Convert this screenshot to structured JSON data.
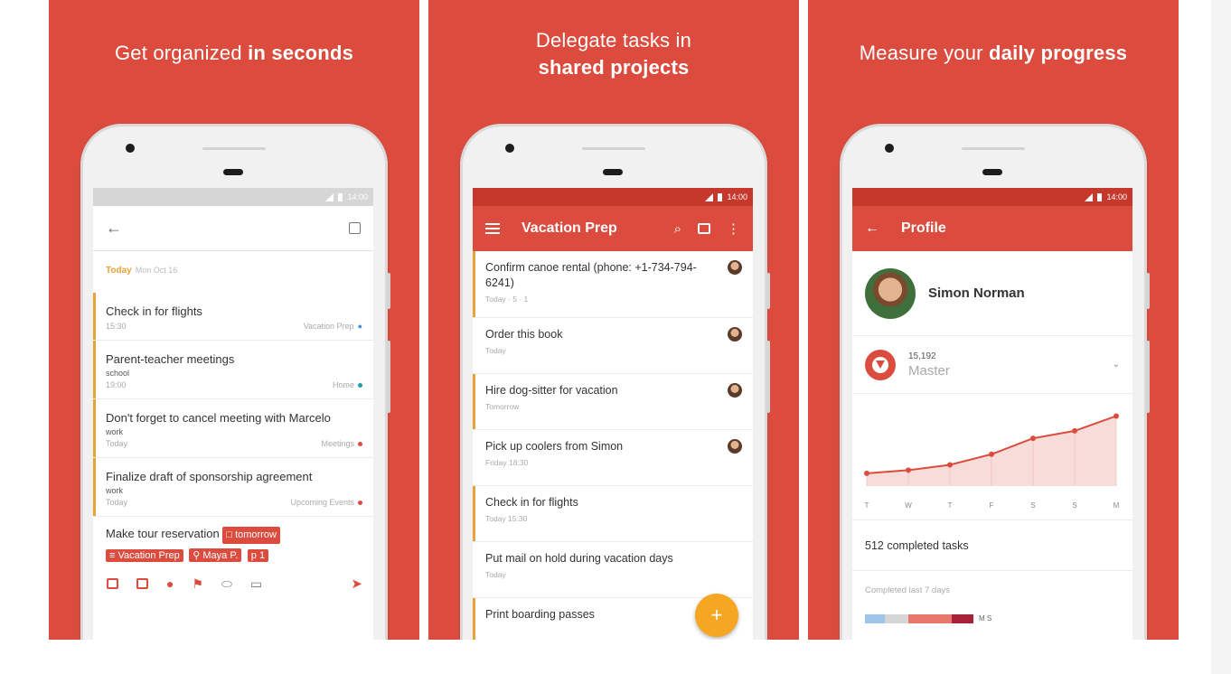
{
  "colors": {
    "brand_red": "#db4c3f",
    "status_red": "#c7382c",
    "today_orange": "#e8a23a",
    "fab_orange": "#f5a623"
  },
  "screens": [
    {
      "caption_pre": "Get organized ",
      "caption_bold": "in seconds",
      "status_time": "14:00",
      "day_label": "Today",
      "day_date": "Mon Oct 16",
      "tasks": [
        {
          "title": "Check in for flights",
          "sub": "",
          "time": "15:30",
          "project": "Vacation Prep"
        },
        {
          "title": "Parent-teacher meetings",
          "sub": "school",
          "time": "19:00",
          "project": "Home"
        },
        {
          "title": "Don't forget to cancel meeting with Marcelo",
          "sub": "work",
          "time": "Today",
          "project": "Meetings"
        },
        {
          "title": "Finalize draft of sponsorship agreement",
          "sub": "work",
          "time": "Today",
          "project": "Upcoming Events"
        }
      ],
      "quick_add": {
        "text": "Make tour reservation",
        "chip_date": "tomorrow",
        "chip_project": "Vacation Prep",
        "chip_assignee": "Maya P.",
        "chip_priority": "1"
      }
    },
    {
      "caption_line1": "Delegate tasks in",
      "caption_line2": "shared projects",
      "status_time": "14:00",
      "toolbar_title": "Vacation Prep",
      "tasks": [
        {
          "title": "Confirm canoe rental (phone: +1-734-794-6241)",
          "meta": "Today · 5 · 1"
        },
        {
          "title": "Order this book",
          "meta": "Today"
        },
        {
          "title": "Hire dog-sitter for vacation",
          "meta": "Tomorrow"
        },
        {
          "title": "Pick up coolers from Simon",
          "meta": "Friday 18:30"
        },
        {
          "title": "Check in for flights",
          "meta": "Today 15:30"
        },
        {
          "title": "Put mail on hold during vacation days",
          "meta": "Today"
        },
        {
          "title": "Print boarding passes",
          "meta": ""
        }
      ],
      "fab_label": "+"
    },
    {
      "caption_pre": "Measure your ",
      "caption_bold": "daily progress",
      "status_time": "14:00",
      "toolbar_title": "Profile",
      "profile_name": "Simon Norman",
      "karma_points": "15,192",
      "karma_level": "Master",
      "completed_tasks": "512 completed tasks",
      "completed_last_7": "Completed last 7 days",
      "week_legend": "M S"
    }
  ],
  "chart_data": {
    "type": "area",
    "categories": [
      "T",
      "W",
      "T",
      "F",
      "S",
      "S",
      "M"
    ],
    "series": [
      {
        "values": [
          12,
          15,
          20,
          30,
          45,
          52,
          66
        ]
      }
    ],
    "ylim": [
      0,
      80
    ],
    "grid": false
  }
}
